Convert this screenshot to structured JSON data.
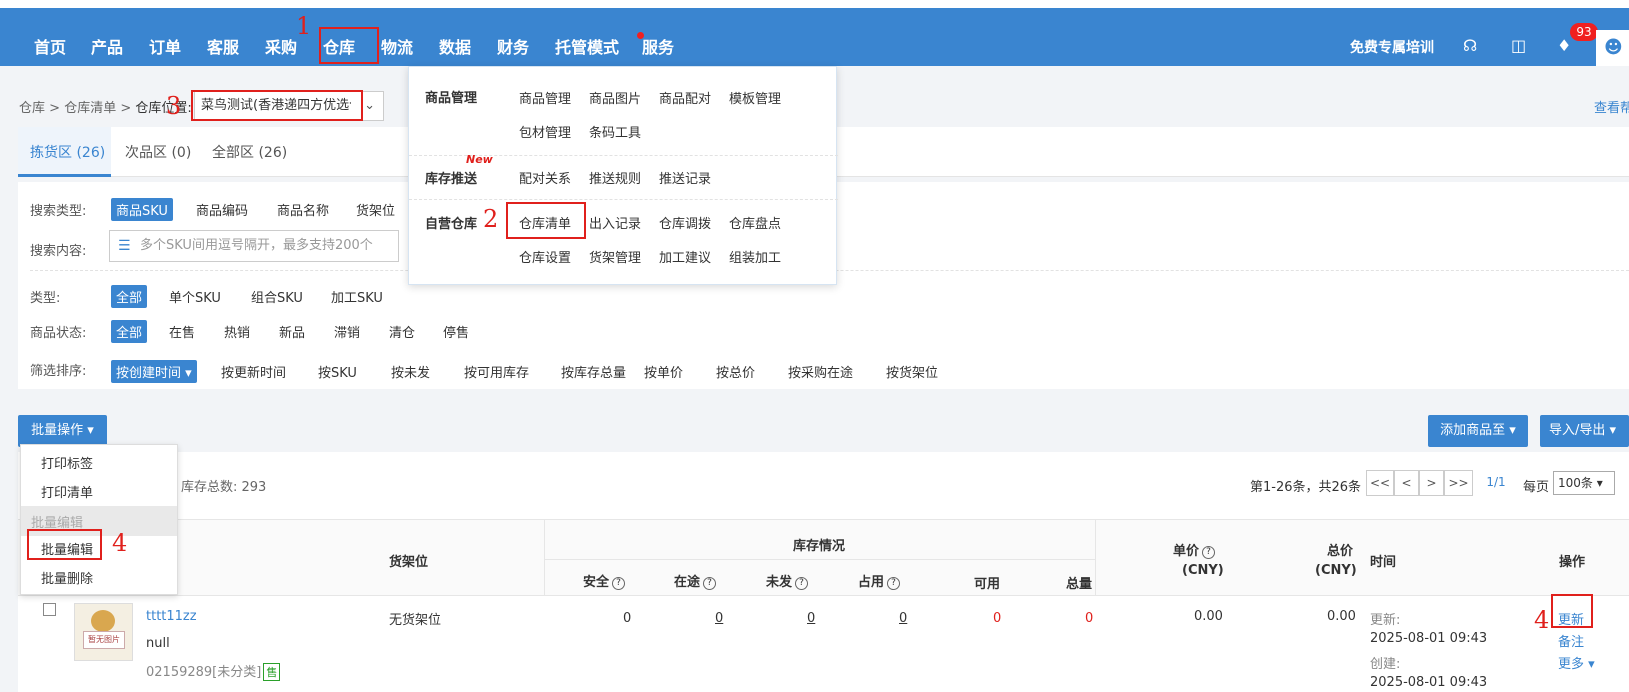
{
  "topnav": {
    "items": [
      "首页",
      "产品",
      "订单",
      "客服",
      "采购",
      "仓库",
      "物流",
      "数据",
      "财务",
      "托管模式",
      "服务"
    ],
    "free_training": "免费专属培训",
    "notification_count": "93"
  },
  "annotations": {
    "n1": "1",
    "n2": "2",
    "n3": "3",
    "n4a": "4",
    "n4b": "4"
  },
  "breadcrumb": {
    "a": "仓库",
    "b": "仓库清单",
    "c": "仓库位置:"
  },
  "warehouse_select": {
    "value": "菜鸟测试(香港递四方优选仓"
  },
  "help_link": "查看帮助",
  "tabs": [
    "拣货区 (26)",
    "次品区 (0)",
    "全部区 (26)"
  ],
  "filters": {
    "search_type_label": "搜索类型:",
    "search_types": [
      "商品SKU",
      "商品编码",
      "商品名称",
      "货架位"
    ],
    "search_content_label": "搜索内容:",
    "search_placeholder": "多个SKU间用逗号隔开，最多支持200个",
    "type_label": "类型:",
    "types": [
      "全部",
      "单个SKU",
      "组合SKU",
      "加工SKU"
    ],
    "status_label": "商品状态:",
    "statuses": [
      "全部",
      "在售",
      "热销",
      "新品",
      "滞销",
      "清仓",
      "停售"
    ],
    "sort_label": "筛选排序:",
    "sorts": [
      "按创建时间 ▾",
      "按更新时间",
      "按SKU",
      "按未发",
      "按可用库存",
      "按库存总量",
      "按单价",
      "按总价",
      "按采购在途",
      "按货架位"
    ]
  },
  "dropdown": {
    "groups": [
      {
        "title": "商品管理",
        "items": [
          "商品管理",
          "商品图片",
          "商品配对",
          "模板管理",
          "包材管理",
          "条码工具"
        ]
      },
      {
        "title": "库存推送",
        "tag": "New",
        "items": [
          "配对关系",
          "推送规则",
          "推送记录"
        ]
      },
      {
        "title": "自营仓库",
        "items": [
          "仓库清单",
          "出入记录",
          "仓库调拨",
          "仓库盘点",
          "仓库设置",
          "货架管理",
          "加工建议",
          "组装加工"
        ]
      }
    ]
  },
  "toolbar": {
    "batch_label": "批量操作 ▾",
    "add_label": "添加商品至 ▾",
    "import_label": "导入/导出 ▾"
  },
  "batch_menu": {
    "items": [
      "打印标签",
      "打印清单",
      "批量编辑",
      "批量编辑",
      "批量删除"
    ]
  },
  "stock_total": "库存总数: 293",
  "pagination": {
    "summary": "第1-26条，共26条",
    "buttons": [
      "<<",
      "<",
      ">",
      ">>",
      "1/1"
    ],
    "per_page_label": "每页",
    "per_page_value": "100条 ▾"
  },
  "table": {
    "headers": {
      "shelf": "货架位",
      "stock": "库存情况",
      "safe": "安全",
      "transit": "在途",
      "unsent": "未发",
      "occupied": "占用",
      "available": "可用",
      "total": "总量",
      "price": "单价",
      "price_unit": "(CNY)",
      "total_price": "总价",
      "total_price_unit": "(CNY)",
      "time": "时间",
      "ops": "操作"
    },
    "rows": [
      {
        "name": "tttt11zz",
        "note": "null",
        "code": "02159289[未分类]",
        "sale_tag": "售",
        "img_text": "暂无图片",
        "shelf": "无货架位",
        "safe": "0",
        "transit": "0",
        "unsent": "0",
        "occupied": "0",
        "available": "0",
        "total": "0",
        "price": "0.00",
        "total_price": "0.00",
        "update_label": "更新:",
        "update_time": "2025-08-01 09:43",
        "create_label": "创建:",
        "create_time": "2025-08-01 09:43",
        "op_update": "更新",
        "op_note": "备注",
        "op_more": "更多 ▾"
      }
    ]
  },
  "colors": {
    "primary": "#3a85d0",
    "annotation_red": "#e0201c"
  },
  "icons": [
    "headset-icon",
    "book-icon",
    "bell-icon",
    "user-icon",
    "question-icon",
    "list-icon"
  ]
}
